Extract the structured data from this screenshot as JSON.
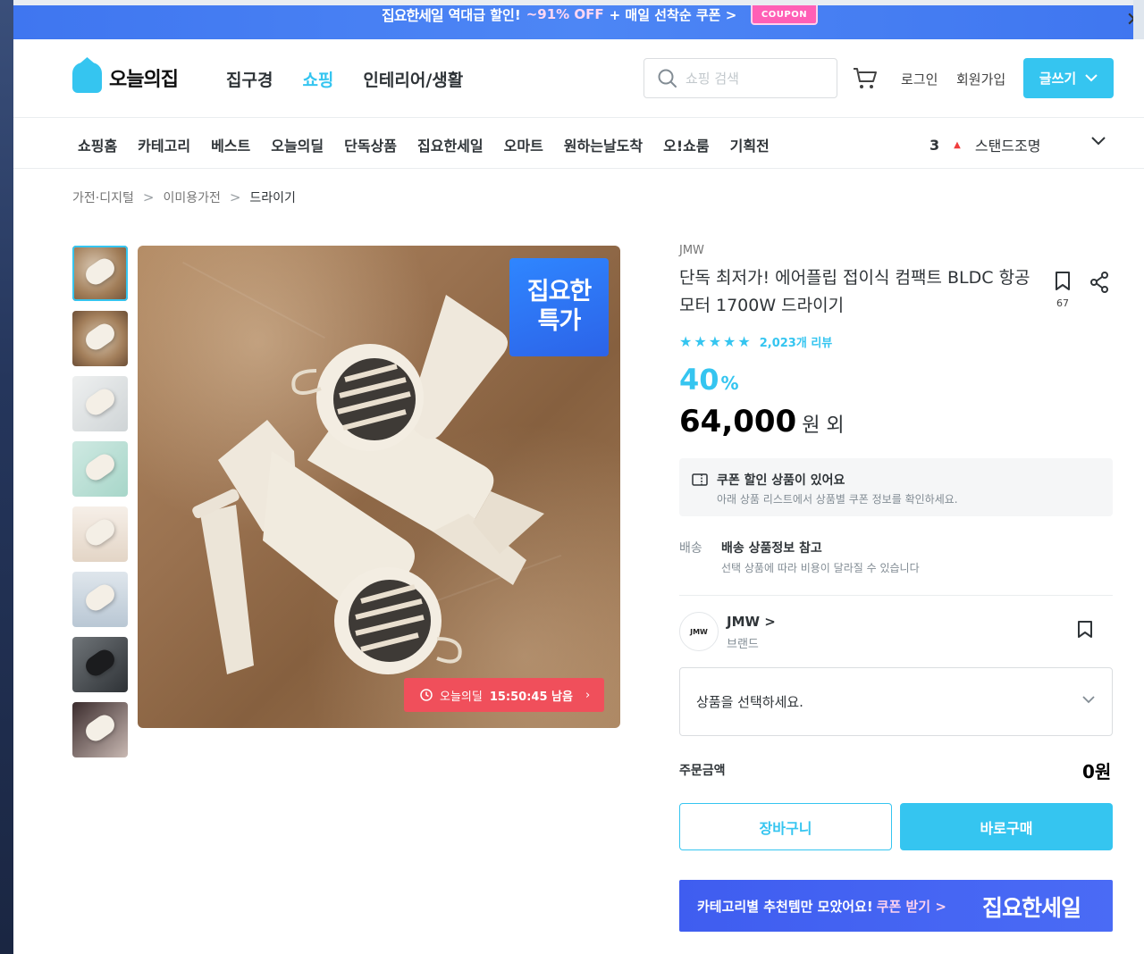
{
  "promo": {
    "brand": "집요한세일",
    "text_before": "역대급 할인!",
    "highlight": "~91% OFF",
    "text_after": "+ 매일 선착순 쿠폰 >",
    "coupon_tag": "COUPON"
  },
  "header": {
    "logo_text": "오늘의집",
    "nav": [
      {
        "label": "집구경",
        "active": false
      },
      {
        "label": "쇼핑",
        "active": true
      },
      {
        "label": "인테리어/생활",
        "active": false
      }
    ],
    "search_placeholder": "쇼핑 검색",
    "login": "로그인",
    "signup": "회원가입",
    "write_label": "글쓰기"
  },
  "sub_nav": {
    "items": [
      "쇼핑홈",
      "카테고리",
      "베스트",
      "오늘의딜",
      "단독상품",
      "집요한세일",
      "오마트",
      "원하는날도착",
      "오!쇼룸",
      "기획전"
    ],
    "ranking_num": "3",
    "ranking_term": "스탠드조명"
  },
  "breadcrumb": [
    "가전·디지털",
    "이미용가전",
    "드라이기"
  ],
  "gallery": {
    "badge_line1": "집요한",
    "badge_line2": "특가",
    "deal_label": "오늘의딜",
    "deal_time": "15:50:45 남음"
  },
  "product": {
    "brand": "JMW",
    "title": "단독 최저가! 에어플립 접이식 컴팩트 BLDC 항공모터 1700W 드라이기",
    "bookmark_count": "67",
    "rating": 5,
    "review_count": "2,023개 리뷰",
    "discount_num": "40",
    "discount_unit": "%",
    "price": "64,000",
    "price_unit": "원 외"
  },
  "coupon": {
    "title": "쿠폰 할인 상품이 있어요",
    "subtitle": "아래 상품 리스트에서 상품별 쿠폰 정보를 확인하세요."
  },
  "shipping": {
    "label": "배송",
    "title": "배송 상품정보 참고",
    "subtitle": "선택 상품에 따라 비용이 달라질 수 있습니다"
  },
  "brand_block": {
    "logo_text": "JMW",
    "name": "JMW >",
    "type": "브랜드"
  },
  "option_select": {
    "placeholder": "상품을 선택하세요."
  },
  "order": {
    "label": "주문금액",
    "total": "0원"
  },
  "buttons": {
    "cart": "장바구니",
    "buy": "바로구매"
  },
  "bottom_banner": {
    "text": "카테고리별 추천템만 모았어요!",
    "link": "쿠폰 받기 >",
    "brand": "집요한세일"
  },
  "colors": {
    "accent": "#35c5f0",
    "promo_blue": "#4a7ff2",
    "deal_red": "#f04f5b",
    "rank_up": "#f03c3c"
  }
}
